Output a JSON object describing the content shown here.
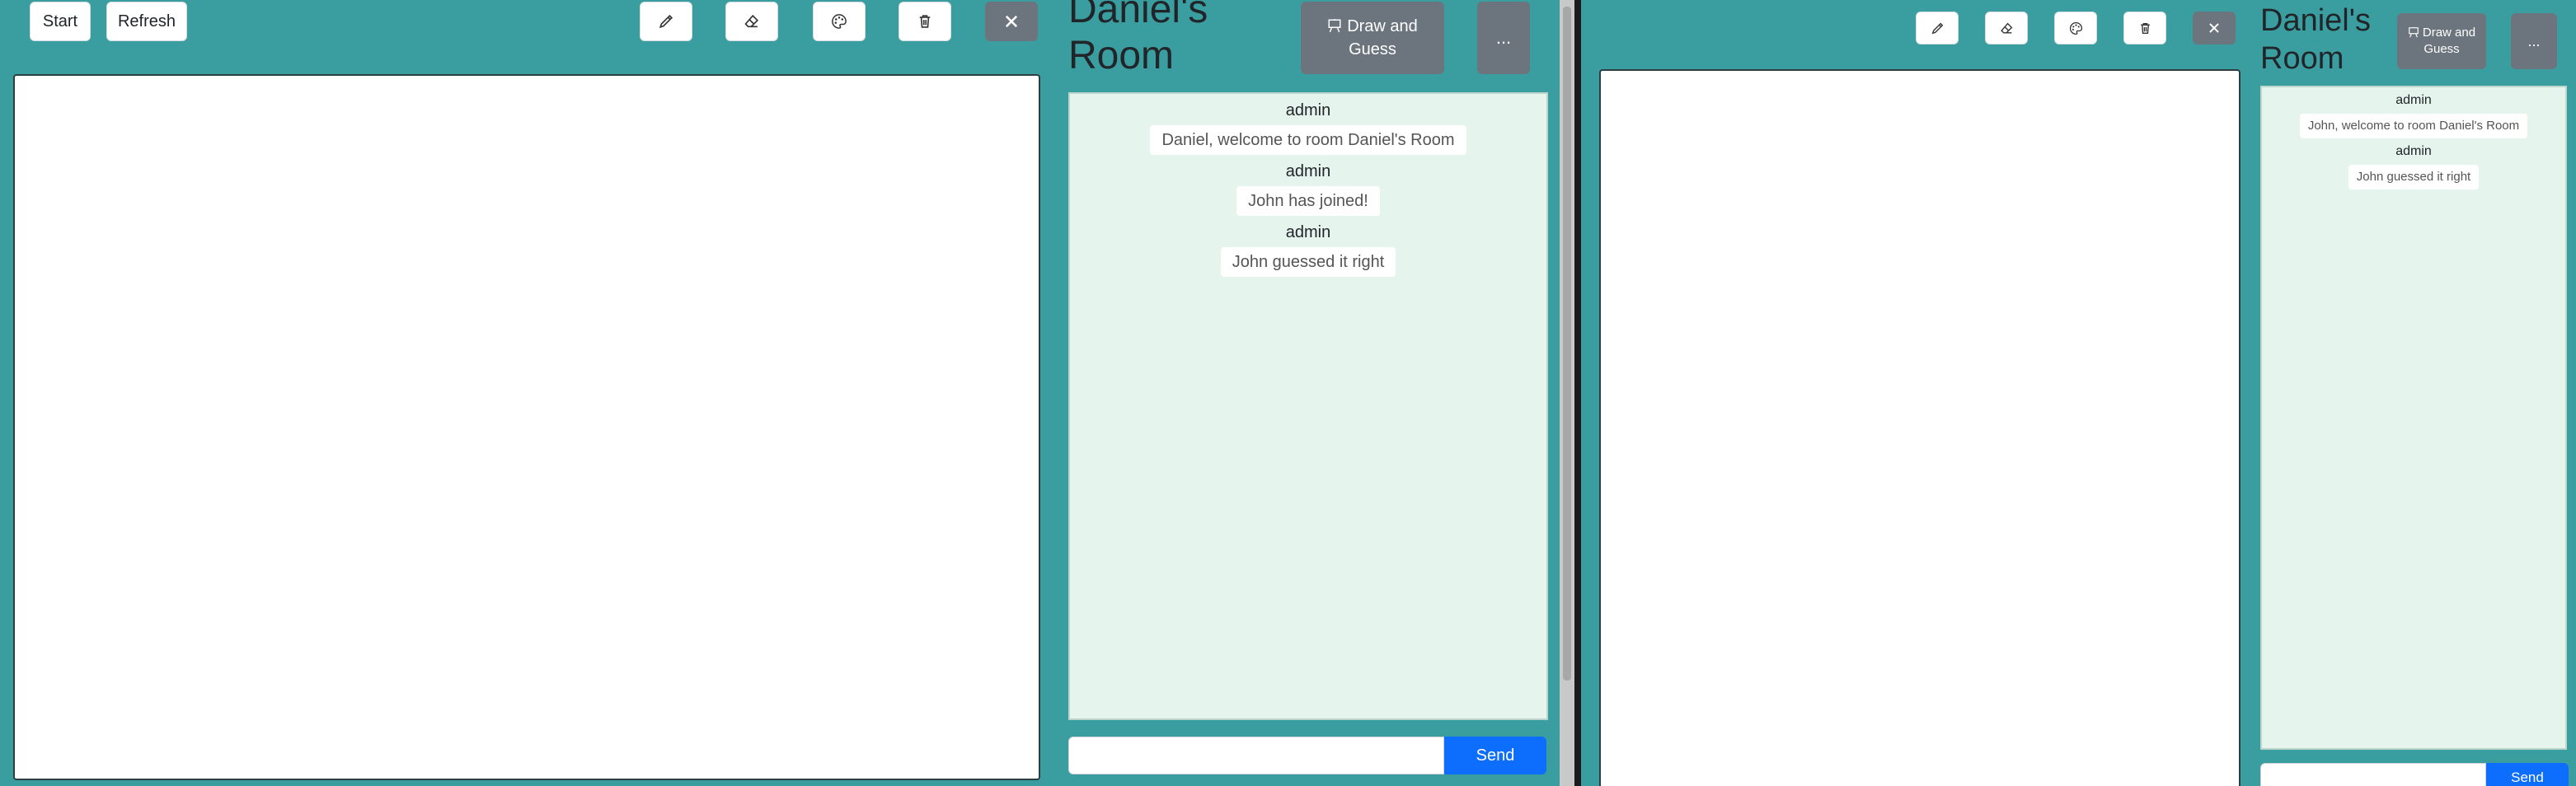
{
  "left": {
    "toolbar": {
      "start_label": "Start",
      "refresh_label": "Refresh"
    },
    "room": {
      "title": "Daniel's Room",
      "game_label": "Draw and Guess",
      "more_label": "..."
    },
    "chat": {
      "messages": [
        {
          "sender": "admin",
          "text": "Daniel, welcome to room Daniel's Room"
        },
        {
          "sender": "admin",
          "text": "John has joined!"
        },
        {
          "sender": "admin",
          "text": "John guessed it right"
        }
      ],
      "send_label": "Send",
      "input_value": ""
    }
  },
  "right": {
    "room": {
      "title": "Daniel's Room",
      "game_label": "Draw and Guess",
      "more_label": "..."
    },
    "chat": {
      "messages": [
        {
          "sender": "admin",
          "text": "John, welcome to room Daniel's Room"
        },
        {
          "sender": "admin",
          "text": "John guessed it right"
        }
      ],
      "send_label": "Send",
      "input_value": ""
    }
  },
  "icons": [
    "pencil-icon",
    "eraser-icon",
    "palette-icon",
    "trash-icon",
    "close-icon",
    "easel-icon"
  ],
  "colors": {
    "background": "#3a9ea0",
    "chat_bg": "#e6f4ee",
    "primary": "#0d6efd",
    "secondary": "#6c757d"
  }
}
